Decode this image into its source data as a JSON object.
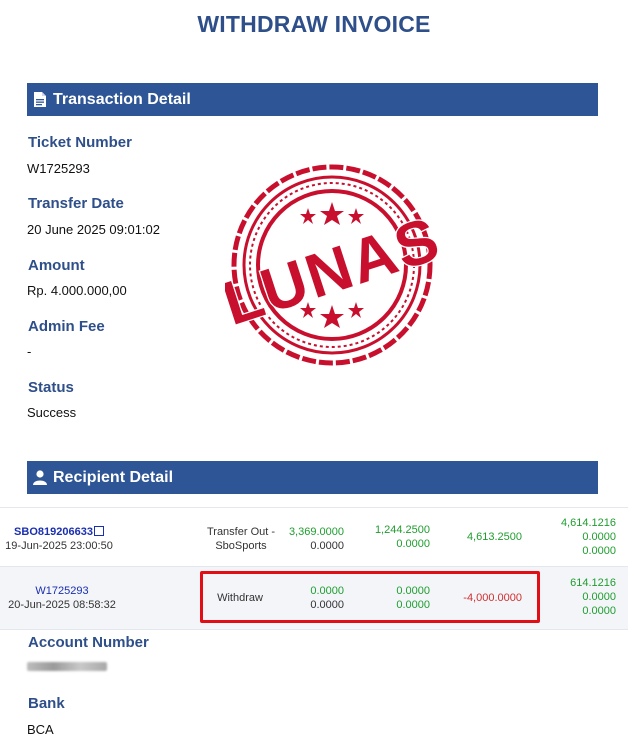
{
  "title": "WITHDRAW INVOICE",
  "transaction": {
    "header": "Transaction Detail",
    "ticket_label": "Ticket Number",
    "ticket_value": "W1725293",
    "date_label": "Transfer Date",
    "date_value": "20 June 2025 09:01:02",
    "amount_label": "Amount",
    "amount_value": "Rp. 4.000.000,00",
    "fee_label": "Admin Fee",
    "fee_value": "-",
    "status_label": "Status",
    "status_value": "Success"
  },
  "stamp": {
    "text": "LUNAS",
    "color": "#c8102e"
  },
  "recipient": {
    "header": "Recipient Detail",
    "account_label": "Account Number",
    "bank_label": "Bank",
    "bank_value": "BCA"
  },
  "rows": [
    {
      "ref": "SBO819206633",
      "date": "19-Jun-2025 23:00:50",
      "type_line1": "Transfer Out -",
      "type_line2": "SboSports",
      "c1a": "3,369.0000",
      "c1b": "0.0000",
      "c2a": "1,244.2500",
      "c2b": "0.0000",
      "c3": "4,613.2500",
      "c4a": "4,614.1216",
      "c4b": "0.0000",
      "c4c": "0.0000"
    },
    {
      "ref": "W1725293",
      "date": "20-Jun-2025 08:58:32",
      "type_line1": "Withdraw",
      "c1a": "0.0000",
      "c1b": "0.0000",
      "c2a": "0.0000",
      "c2b": "0.0000",
      "c3": "-4,000.0000",
      "c4a": "614.1216",
      "c4b": "0.0000",
      "c4c": "0.0000"
    }
  ],
  "colors": {
    "accent": "#2e5595",
    "heading": "#2e4f8a",
    "positive": "#1f9d2f",
    "negative": "#d03030",
    "highlight": "#e20e16"
  }
}
